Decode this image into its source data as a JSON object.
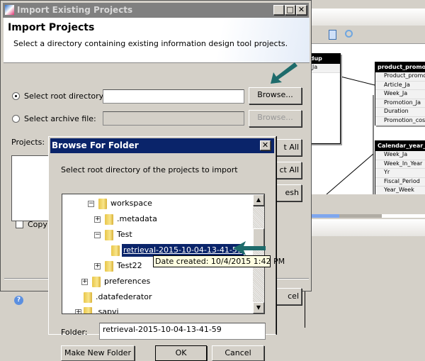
{
  "main_dialog": {
    "title": "Import Existing Projects",
    "header_title": "Import Projects",
    "header_subtitle": "Select a directory containing existing information design tool projects.",
    "root_dir_label": "Select root directory:",
    "root_dir_value": "",
    "archive_label": "Select archive file:",
    "browse_label": "Browse...",
    "browse_archive_label": "Browse...",
    "projects_label": "Projects:",
    "select_all_partial": "t All",
    "deselect_all_partial": "ct All",
    "refresh_partial": "esh",
    "copy_label": "Copy",
    "cancel_partial": "cel",
    "selected_option": "root directory"
  },
  "browse_dialog": {
    "title": "Browse For Folder",
    "instruction": "Select root directory of the projects to import",
    "tree": [
      {
        "label": "workspace",
        "expander": "minus"
      },
      {
        "label": ".metadata",
        "expander": "plus"
      },
      {
        "label": "Test",
        "expander": "minus"
      },
      {
        "label": "retrieval-2015-10-04-13-41-59",
        "expander": "none",
        "selected": true
      },
      {
        "label": "Test22",
        "expander": "plus"
      },
      {
        "label": "preferences",
        "expander": "plus"
      },
      {
        "label": ".datafederator",
        "expander": "none"
      },
      {
        "label": ".sapvi",
        "expander": "plus"
      }
    ],
    "tooltip": "Date created: 10/4/2015 1:42 PM",
    "folder_label": "Folder:",
    "folder_value": "retrieval-2015-10-04-13-41-59",
    "make_new_folder": "Make New Folder",
    "ok": "OK",
    "cancel": "Cancel"
  },
  "background": {
    "entity_partial": {
      "title": "cdup",
      "rows": [
        "o_Ja"
      ]
    },
    "entity_product": {
      "title": "product_promo",
      "rows": [
        "Product_promotion",
        "Article_Ja",
        "Week_Ja",
        "Promotion_Ja",
        "Duration",
        "Promotion_cost"
      ]
    },
    "entity_calendar": {
      "title": "Calendar_year_",
      "rows": [
        "Week_Ja",
        "Week_In_Year",
        "Yr",
        "Fiscal_Period",
        "Year_Week"
      ]
    }
  },
  "colors": {
    "title_active": "#0a246a",
    "arrow": "#1e6b6b",
    "selection": "#0a246a",
    "tooltip_bg": "#ffffe1"
  }
}
